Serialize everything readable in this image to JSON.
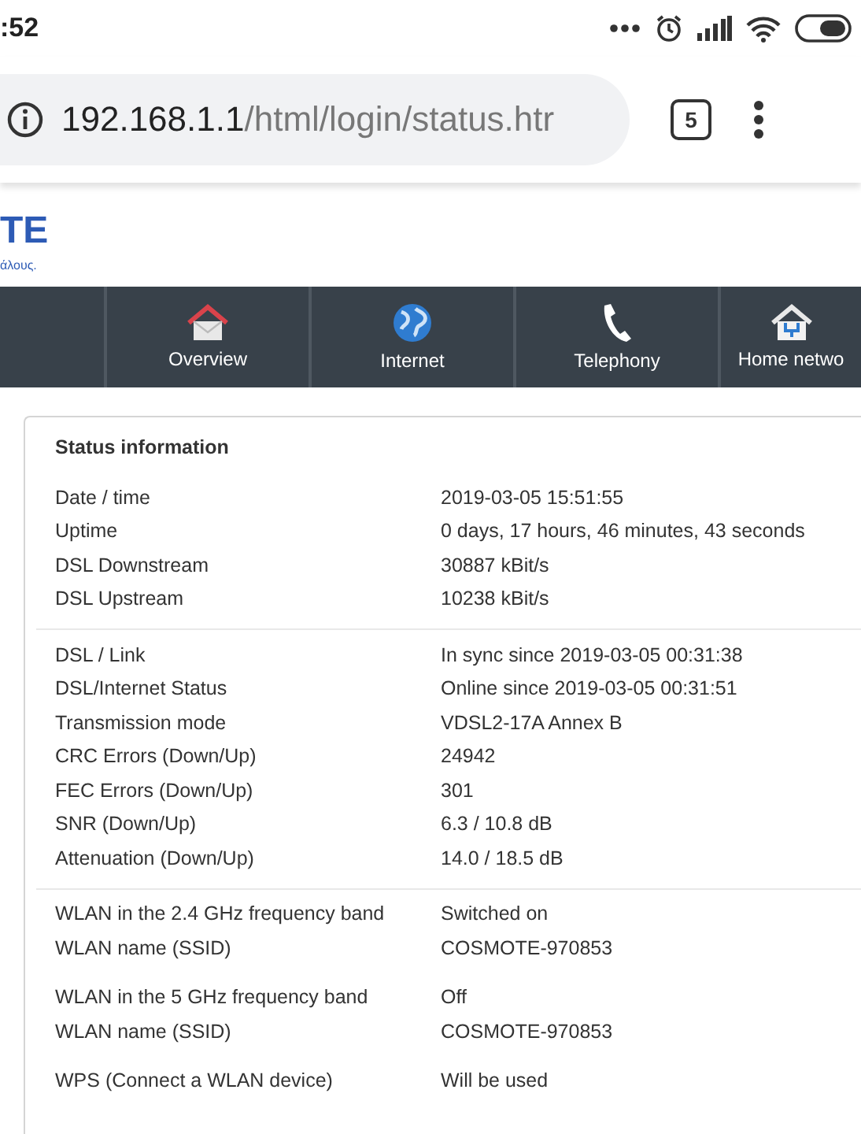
{
  "status_bar": {
    "time": ":52"
  },
  "browser": {
    "url_host": "192.168.1.1",
    "url_path": "/html/login/status.htr",
    "tab_count": "5"
  },
  "logo": {
    "text": "TE",
    "tagline": "άλους."
  },
  "nav": [
    {
      "kind": "blank"
    },
    {
      "label": "Overview",
      "kind": "house"
    },
    {
      "label": "Internet",
      "kind": "globe"
    },
    {
      "label": "Telephony",
      "kind": "phone"
    },
    {
      "label": "Home netwo",
      "kind": "network"
    }
  ],
  "panel": {
    "title": "Status information",
    "sections": [
      [
        [
          {
            "label": "Date / time",
            "value": "2019-03-05 15:51:55"
          },
          {
            "label": "Uptime",
            "value": "0 days, 17 hours, 46 minutes, 43 seconds"
          },
          {
            "label": "DSL Downstream",
            "value": "30887 kBit/s"
          },
          {
            "label": "DSL Upstream",
            "value": "10238 kBit/s"
          }
        ]
      ],
      [
        [
          {
            "label": "DSL / Link",
            "value": "In sync since 2019-03-05 00:31:38"
          },
          {
            "label": "DSL/Internet Status",
            "value": "Online since 2019-03-05 00:31:51"
          },
          {
            "label": "Transmission mode",
            "value": "VDSL2-17A Annex B"
          },
          {
            "label": "CRC Errors (Down/Up)",
            "value": "24942"
          },
          {
            "label": "FEC Errors (Down/Up)",
            "value": "301"
          },
          {
            "label": "SNR (Down/Up)",
            "value": "6.3 / 10.8 dB"
          },
          {
            "label": "Attenuation (Down/Up)",
            "value": "14.0 / 18.5 dB"
          }
        ]
      ],
      [
        [
          {
            "label": "WLAN in the 2.4 GHz frequency band",
            "value": "Switched on"
          },
          {
            "label": "WLAN name (SSID)",
            "value": "COSMOTE-970853"
          }
        ],
        [
          {
            "label": "WLAN in the 5 GHz frequency band",
            "value": "Off"
          },
          {
            "label": "WLAN name (SSID)",
            "value": "COSMOTE-970853"
          }
        ],
        [
          {
            "label": "WPS (Connect a WLAN device)",
            "value": "Will be used"
          }
        ]
      ]
    ]
  }
}
